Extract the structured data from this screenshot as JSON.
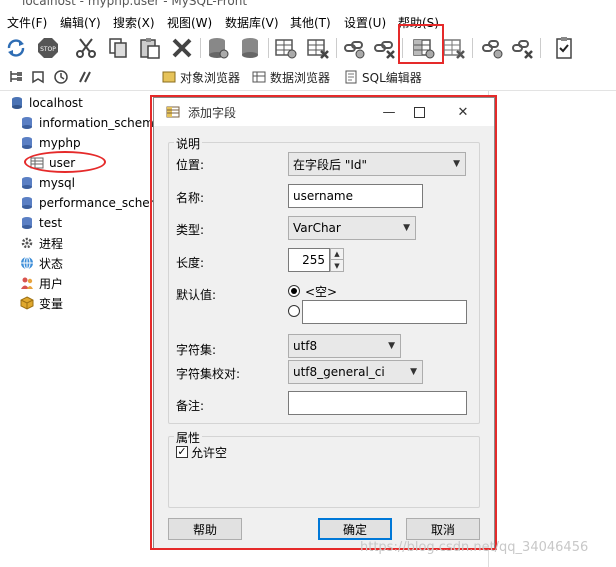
{
  "window": {
    "title": "localhost - myphp.user - MySQL-Front"
  },
  "menu": [
    "文件(F)",
    "编辑(Y)",
    "搜索(X)",
    "视图(W)",
    "数据库(V)",
    "其他(T)",
    "设置(U)",
    "帮助(S)"
  ],
  "toolbar2": {
    "object_browser": "对象浏览器",
    "data_browser": "数据浏览器",
    "sql_editor": "SQL编辑器"
  },
  "tree": [
    {
      "label": "localhost",
      "icon": "server-icon"
    },
    {
      "label": "information_schem",
      "icon": "database-icon"
    },
    {
      "label": "myphp",
      "icon": "database-icon"
    },
    {
      "label": "user",
      "icon": "table-icon"
    },
    {
      "label": "mysql",
      "icon": "database-icon"
    },
    {
      "label": "performance_scher",
      "icon": "database-icon"
    },
    {
      "label": "test",
      "icon": "database-icon"
    },
    {
      "label": "进程",
      "icon": "process-icon"
    },
    {
      "label": "状态",
      "icon": "status-icon"
    },
    {
      "label": "用户",
      "icon": "users-icon"
    },
    {
      "label": "变量",
      "icon": "variables-icon"
    }
  ],
  "dialog": {
    "title": "添加字段",
    "group_desc": "说明",
    "position_label": "位置:",
    "position_value": "在字段后 \"Id\"",
    "name_label": "名称:",
    "name_value": "username",
    "type_label": "类型:",
    "type_value": "VarChar",
    "length_label": "长度:",
    "length_value": "255",
    "default_label": "默认值:",
    "default_option_null": "<空>",
    "default_value": "",
    "charset_label": "字符集:",
    "charset_value": "utf8",
    "collation_label": "字符集校对:",
    "collation_value": "utf8_general_ci",
    "comment_label": "备注:",
    "comment_value": "",
    "group_attr": "属性",
    "allow_null_label": "允许空",
    "allow_null_checked": true,
    "help_button": "帮助",
    "ok_button": "确定",
    "cancel_button": "取消"
  },
  "watermark": "https://blog.csdn.net/qq_34046456",
  "colors": {
    "highlight_red": "#e52a2a",
    "accent_blue": "#0078d7"
  }
}
